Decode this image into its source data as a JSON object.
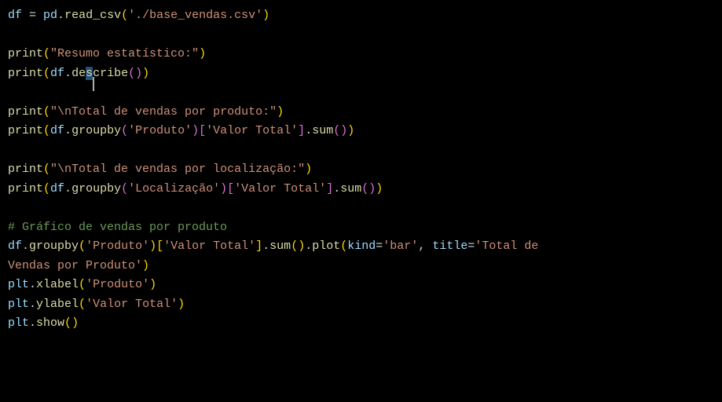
{
  "code": {
    "l1_var": "df",
    "l1_eq": " = ",
    "l1_pd": "pd",
    "l1_dot": ".",
    "l1_read": "read_csv",
    "l1_lp": "(",
    "l1_str": "'./base_vendas.csv'",
    "l1_rp": ")",
    "l3_print": "print",
    "l3_lp": "(",
    "l3_str": "\"Resumo estatístico:\"",
    "l3_rp": ")",
    "l4_print": "print",
    "l4_lp": "(",
    "l4_df": "df",
    "l4_dot": ".",
    "l4_desc_pre": "de",
    "l4_desc_sel": "s",
    "l4_desc_post": "cribe",
    "l4_ilp": "(",
    "l4_irp": ")",
    "l4_rp": ")",
    "l6_print": "print",
    "l6_lp": "(",
    "l6_str": "\"\\nTotal de vendas por produto:\"",
    "l6_rp": ")",
    "l7_print": "print",
    "l7_lp": "(",
    "l7_df": "df",
    "l7_dot": ".",
    "l7_groupby": "groupby",
    "l7_glp": "(",
    "l7_gstr": "'Produto'",
    "l7_grp": ")",
    "l7_blp": "[",
    "l7_bstr": "'Valor Total'",
    "l7_brp": "]",
    "l7_dot2": ".",
    "l7_sum": "sum",
    "l7_slp": "(",
    "l7_srp": ")",
    "l7_rp": ")",
    "l9_print": "print",
    "l9_lp": "(",
    "l9_str": "\"\\nTotal de vendas por localização:\"",
    "l9_rp": ")",
    "l10_print": "print",
    "l10_lp": "(",
    "l10_df": "df",
    "l10_dot": ".",
    "l10_groupby": "groupby",
    "l10_glp": "(",
    "l10_gstr": "'Localização'",
    "l10_grp": ")",
    "l10_blp": "[",
    "l10_bstr": "'Valor Total'",
    "l10_brp": "]",
    "l10_dot2": ".",
    "l10_sum": "sum",
    "l10_slp": "(",
    "l10_srp": ")",
    "l10_rp": ")",
    "l12_cmt": "# Gráfico de vendas por produto",
    "l13_df": "df",
    "l13_dot": ".",
    "l13_groupby": "groupby",
    "l13_glp": "(",
    "l13_gstr": "'Produto'",
    "l13_grp": ")",
    "l13_blp": "[",
    "l13_bstr": "'Valor Total'",
    "l13_brp": "]",
    "l13_dot2": ".",
    "l13_sum": "sum",
    "l13_slp": "(",
    "l13_srp": ")",
    "l13_dot3": ".",
    "l13_plot": "plot",
    "l13_plp": "(",
    "l13_kind": "kind",
    "l13_eq1": "=",
    "l13_kstr": "'bar'",
    "l13_comma": ", ",
    "l13_title": "title",
    "l13_eq2": "=",
    "l13_tstr1": "'Total de ",
    "l14_tstr2": "Vendas por Produto'",
    "l14_prp": ")",
    "l15_plt": "plt",
    "l15_dot": ".",
    "l15_xlabel": "xlabel",
    "l15_lp": "(",
    "l15_str": "'Produto'",
    "l15_rp": ")",
    "l16_plt": "plt",
    "l16_dot": ".",
    "l16_ylabel": "ylabel",
    "l16_lp": "(",
    "l16_str": "'Valor Total'",
    "l16_rp": ")",
    "l17_plt": "plt",
    "l17_dot": ".",
    "l17_show": "show",
    "l17_lp": "(",
    "l17_rp": ")"
  }
}
